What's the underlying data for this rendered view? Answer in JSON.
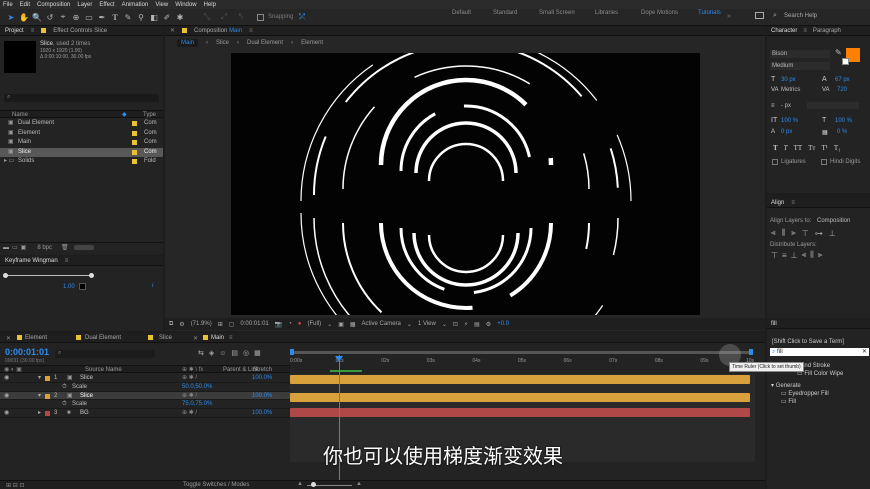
{
  "menu": [
    "File",
    "Edit",
    "Composition",
    "Layer",
    "Effect",
    "Animation",
    "View",
    "Window",
    "Help"
  ],
  "toolbar": {
    "snapping": "Snapping",
    "workspaces": [
      "Default",
      "Standard",
      "Small Screen",
      "Libraries",
      "Dope Motions",
      "Tutorials"
    ],
    "active_workspace": "Tutorials",
    "search_placeholder": "Search Help"
  },
  "project": {
    "tab_project": "Project",
    "tab_effect": "Effect Controls Slice",
    "item_name": "Slice",
    "item_used": ", used 2 times",
    "item_dims": "1920 x 1920 (1.00)",
    "item_dur": "Δ 0:00:10:00, 30.00 fps",
    "col_name": "Name",
    "col_type": "Type",
    "items": [
      {
        "name": "Dual Element",
        "type": "Com"
      },
      {
        "name": "Element",
        "type": "Com"
      },
      {
        "name": "Main",
        "type": "Com"
      },
      {
        "name": "Slice",
        "type": "Com"
      },
      {
        "name": "Solids",
        "type": "Fold"
      }
    ],
    "bpc": "8 bpc"
  },
  "wingman": {
    "title": "Keyframe Wingman",
    "value": "1.00"
  },
  "comp": {
    "tab_prefix": "Composition",
    "tab_name": "Main",
    "breadcrumbs": [
      "Main",
      "Slice",
      "Dual Element",
      "Element"
    ],
    "zoom": "(71.9%)",
    "time": "0:00:01:01",
    "quality": "(Full)",
    "camera": "Active Camera",
    "view": "1 View",
    "exposure": "+0.0"
  },
  "character": {
    "tab": "Character",
    "tab2": "Paragraph",
    "font": "Bison",
    "style": "Medium",
    "size": "30 px",
    "leading": "67 px",
    "kern": "Metrics",
    "track": "720",
    "stroke": "- px",
    "vscale": "100 %",
    "hscale": "100 %",
    "baseline": "0 px",
    "tsume": "0 %",
    "styles": [
      "T",
      "T",
      "TT",
      "Tт",
      "T¹",
      "T₁"
    ],
    "ligatures": "Ligatures",
    "hindi": "Hindi Digits"
  },
  "align": {
    "title": "Align",
    "align_to_label": "Align Layers to:",
    "align_to": "Composition",
    "distribute": "Distribute Layers:"
  },
  "effects": {
    "tab": "fill",
    "hint": "[Shift Click to Save a Term]",
    "search": "fill",
    "tooltip": "Time Ruler (Click to set thumb)",
    "groups": [
      {
        "name": "",
        "items": [
          "Fill and Stroke",
          "Fill Color Wipe"
        ]
      },
      {
        "name": "Generate",
        "items": [
          "Eyedropper Fill",
          "Fill"
        ]
      }
    ]
  },
  "timeline": {
    "tabs": [
      "Element",
      "Dual Element",
      "Slice",
      "Main"
    ],
    "timecode": "0:00:01:01",
    "frames": "00031 (30.00 fps)",
    "col_source": "Source Name",
    "col_parent": "Parent & Link",
    "col_stretch": "Stretch",
    "ruler": [
      "0:00s",
      "01s",
      "02s",
      "03s",
      "04s",
      "05s",
      "06s",
      "07s",
      "08s",
      "09s",
      "10s"
    ],
    "layers": [
      {
        "num": "1",
        "name": "Slice",
        "stretch": "100.0%",
        "color": "#d9a13c"
      },
      {
        "num": "",
        "name": "Scale",
        "value": "50.0,50.0%",
        "stretch": "",
        "color": ""
      },
      {
        "num": "2",
        "name": "Slice",
        "stretch": "100.0%",
        "color": "#d9a13c"
      },
      {
        "num": "",
        "name": "Scale",
        "value": "75.0,75.0%",
        "stretch": "",
        "color": ""
      },
      {
        "num": "3",
        "name": "BG",
        "stretch": "100.0%",
        "color": "#b04848"
      }
    ],
    "toggle": "Toggle Switches / Modes"
  },
  "subtitle": "你也可以使用梯度渐变效果",
  "colors": {
    "accent": "#2d8ceb",
    "orange_swatch": "#ff8000",
    "bar_gold": "#d9a13c",
    "bar_red": "#b04848"
  }
}
